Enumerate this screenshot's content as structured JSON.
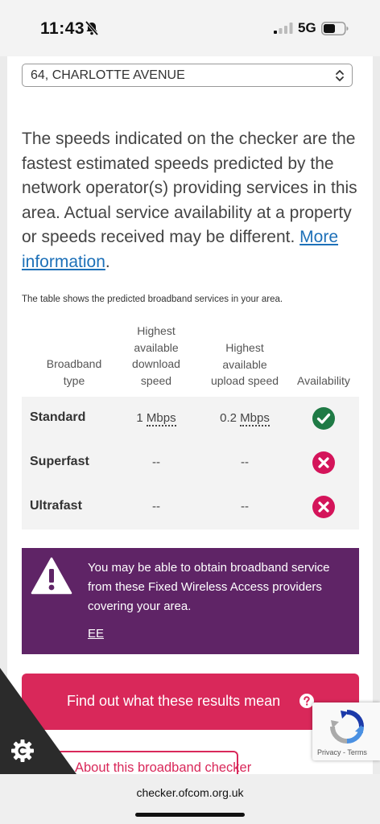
{
  "status_bar": {
    "time": "11:43",
    "network": "5G"
  },
  "address_select": {
    "value": "64, CHARLOTTE AVENUE"
  },
  "info": {
    "text": "The speeds indicated on the checker are the fastest estimated speeds predicted by the network operator(s) providing services in this area. Actual service availability at a property or speeds received may be different.",
    "link_label": "More information",
    "trailing": "."
  },
  "table": {
    "caption": "The table shows the predicted broadband services in your area.",
    "headers": {
      "type": [
        "Broadband",
        "type"
      ],
      "download": [
        "Highest",
        "available",
        "download",
        "speed"
      ],
      "upload": [
        "Highest",
        "available",
        "upload speed"
      ],
      "availability": "Availability"
    },
    "rows": [
      {
        "type": "Standard",
        "download_value": "1",
        "download_unit": "Mbps",
        "upload_value": "0.2",
        "upload_unit": "Mbps",
        "available": true
      },
      {
        "type": "Superfast",
        "download": "--",
        "upload": "--",
        "available": false
      },
      {
        "type": "Ultrafast",
        "download": "--",
        "upload": "--",
        "available": false
      }
    ]
  },
  "fwa_banner": {
    "text": "You may be able to obtain broadband service from these Fixed Wireless Access providers covering your area.",
    "provider": "EE"
  },
  "buttons": {
    "results": "Find out what these results mean",
    "about": "About this broadband checker"
  },
  "recaptcha": {
    "privacy": "Privacy",
    "separator": " - ",
    "terms": "Terms"
  },
  "browser": {
    "url": "checker.ofcom.org.uk"
  },
  "colors": {
    "brand_pink": "#d9285a",
    "banner_purple": "#5f2466",
    "link_blue": "#1d70b8",
    "available_green": "#1f7a45",
    "unavailable_pink": "#d4145a"
  },
  "icons": [
    "bell-slash-icon",
    "signal-icon",
    "battery-icon",
    "chevron-updown-icon",
    "check-circle-icon",
    "cross-circle-icon",
    "warning-icon",
    "help-circle-icon",
    "gear-icon",
    "recaptcha-icon"
  ]
}
